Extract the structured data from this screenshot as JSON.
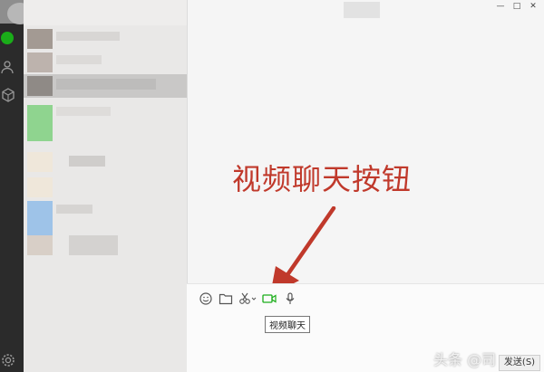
{
  "window": {
    "minimize_label": "—",
    "maximize_label": "□",
    "close_label": "✕"
  },
  "annotation": {
    "text": "视频聊天按钮"
  },
  "toolbar": {
    "icons": [
      "emoji-icon",
      "folder-icon",
      "scissors-icon",
      "video-chat-icon",
      "microphone-icon"
    ],
    "tooltip": "视频聊天"
  },
  "send_button": {
    "label": "发送(S)"
  },
  "watermark": {
    "text": "头条 @司"
  },
  "colors": {
    "rail": "#2b2b2b",
    "online_dot": "#1aad19",
    "accent_video": "#1aad19",
    "annotation_red": "#c0392b"
  }
}
